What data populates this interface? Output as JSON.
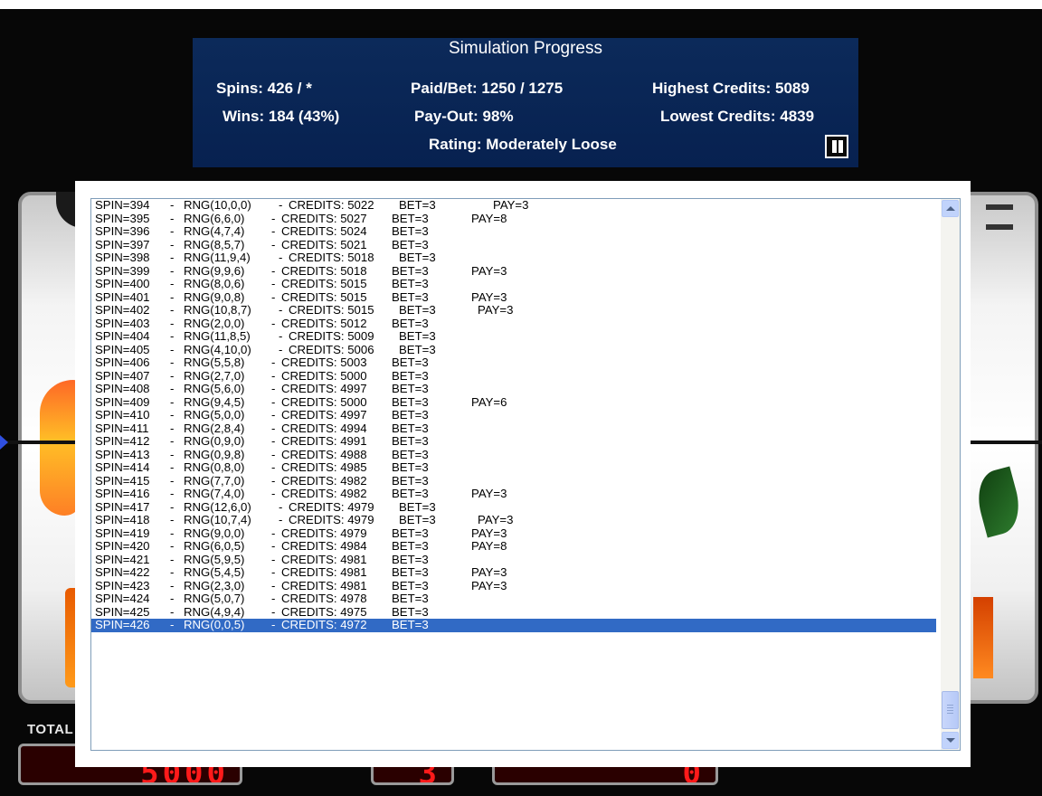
{
  "progress": {
    "title": "Simulation Progress",
    "spins": "Spins: 426 / *",
    "wins": "Wins: 184 (43%)",
    "paid_bet": "Paid/Bet: 1250 / 1275",
    "payout": "Pay-Out: 98%",
    "highest_credits": "Highest Credits: 5089",
    "lowest_credits": "Lowest Credits: 4839",
    "rating": "Rating: Moderately Loose"
  },
  "background": {
    "total_label": "TOTAL",
    "total_meter": "5000",
    "bet_meter": "3",
    "win_meter": "0"
  },
  "log": [
    {
      "spin": "SPIN=394",
      "rng": "RNG(10,0,0)",
      "credits": "CREDITS: 5022",
      "bet": "BET=3",
      "pay": "PAY=3",
      "payx": 444
    },
    {
      "spin": "SPIN=395",
      "rng": "RNG(6,6,0)",
      "credits": "CREDITS: 5027",
      "bet": "BET=3",
      "pay": "PAY=8",
      "payx": 420
    },
    {
      "spin": "SPIN=396",
      "rng": "RNG(4,7,4)",
      "credits": "CREDITS: 5024",
      "bet": "BET=3",
      "pay": ""
    },
    {
      "spin": "SPIN=397",
      "rng": "RNG(8,5,7)",
      "credits": "CREDITS: 5021",
      "bet": "BET=3",
      "pay": ""
    },
    {
      "spin": "SPIN=398",
      "rng": "RNG(11,9,4)",
      "credits": "CREDITS: 5018",
      "bet": "BET=3",
      "pay": ""
    },
    {
      "spin": "SPIN=399",
      "rng": "RNG(9,9,6)",
      "credits": "CREDITS: 5018",
      "bet": "BET=3",
      "pay": "PAY=3",
      "payx": 420
    },
    {
      "spin": "SPIN=400",
      "rng": "RNG(8,0,6)",
      "credits": "CREDITS: 5015",
      "bet": "BET=3",
      "pay": ""
    },
    {
      "spin": "SPIN=401",
      "rng": "RNG(9,0,8)",
      "credits": "CREDITS: 5015",
      "bet": "BET=3",
      "pay": "PAY=3",
      "payx": 420
    },
    {
      "spin": "SPIN=402",
      "rng": "RNG(10,8,7)",
      "credits": "CREDITS: 5015",
      "bet": "BET=3",
      "pay": "PAY=3",
      "payx": 427
    },
    {
      "spin": "SPIN=403",
      "rng": "RNG(2,0,0)",
      "credits": "CREDITS: 5012",
      "bet": "BET=3",
      "pay": ""
    },
    {
      "spin": "SPIN=404",
      "rng": "RNG(11,8,5)",
      "credits": "CREDITS: 5009",
      "bet": "BET=3",
      "pay": ""
    },
    {
      "spin": "SPIN=405",
      "rng": "RNG(4,10,0)",
      "credits": "CREDITS: 5006",
      "bet": "BET=3",
      "pay": ""
    },
    {
      "spin": "SPIN=406",
      "rng": "RNG(5,5,8)",
      "credits": "CREDITS: 5003",
      "bet": "BET=3",
      "pay": ""
    },
    {
      "spin": "SPIN=407",
      "rng": "RNG(2,7,0)",
      "credits": "CREDITS: 5000",
      "bet": "BET=3",
      "pay": ""
    },
    {
      "spin": "SPIN=408",
      "rng": "RNG(5,6,0)",
      "credits": "CREDITS: 4997",
      "bet": "BET=3",
      "pay": ""
    },
    {
      "spin": "SPIN=409",
      "rng": "RNG(9,4,5)",
      "credits": "CREDITS: 5000",
      "bet": "BET=3",
      "pay": "PAY=6",
      "payx": 420
    },
    {
      "spin": "SPIN=410",
      "rng": "RNG(5,0,0)",
      "credits": "CREDITS: 4997",
      "bet": "BET=3",
      "pay": ""
    },
    {
      "spin": "SPIN=411",
      "rng": "RNG(2,8,4)",
      "credits": "CREDITS: 4994",
      "bet": "BET=3",
      "pay": ""
    },
    {
      "spin": "SPIN=412",
      "rng": "RNG(0,9,0)",
      "credits": "CREDITS: 4991",
      "bet": "BET=3",
      "pay": ""
    },
    {
      "spin": "SPIN=413",
      "rng": "RNG(0,9,8)",
      "credits": "CREDITS: 4988",
      "bet": "BET=3",
      "pay": ""
    },
    {
      "spin": "SPIN=414",
      "rng": "RNG(0,8,0)",
      "credits": "CREDITS: 4985",
      "bet": "BET=3",
      "pay": ""
    },
    {
      "spin": "SPIN=415",
      "rng": "RNG(7,7,0)",
      "credits": "CREDITS: 4982",
      "bet": "BET=3",
      "pay": ""
    },
    {
      "spin": "SPIN=416",
      "rng": "RNG(7,4,0)",
      "credits": "CREDITS: 4982",
      "bet": "BET=3",
      "pay": "PAY=3",
      "payx": 420
    },
    {
      "spin": "SPIN=417",
      "rng": "RNG(12,6,0)",
      "credits": "CREDITS: 4979",
      "bet": "BET=3",
      "pay": ""
    },
    {
      "spin": "SPIN=418",
      "rng": "RNG(10,7,4)",
      "credits": "CREDITS: 4979",
      "bet": "BET=3",
      "pay": "PAY=3",
      "payx": 427
    },
    {
      "spin": "SPIN=419",
      "rng": "RNG(9,0,0)",
      "credits": "CREDITS: 4979",
      "bet": "BET=3",
      "pay": "PAY=3",
      "payx": 420
    },
    {
      "spin": "SPIN=420",
      "rng": "RNG(6,0,5)",
      "credits": "CREDITS: 4984",
      "bet": "BET=3",
      "pay": "PAY=8",
      "payx": 420
    },
    {
      "spin": "SPIN=421",
      "rng": "RNG(5,9,5)",
      "credits": "CREDITS: 4981",
      "bet": "BET=3",
      "pay": ""
    },
    {
      "spin": "SPIN=422",
      "rng": "RNG(5,4,5)",
      "credits": "CREDITS: 4981",
      "bet": "BET=3",
      "pay": "PAY=3",
      "payx": 420
    },
    {
      "spin": "SPIN=423",
      "rng": "RNG(2,3,0)",
      "credits": "CREDITS: 4981",
      "bet": "BET=3",
      "pay": "PAY=3",
      "payx": 420
    },
    {
      "spin": "SPIN=424",
      "rng": "RNG(5,0,7)",
      "credits": "CREDITS: 4978",
      "bet": "BET=3",
      "pay": ""
    },
    {
      "spin": "SPIN=425",
      "rng": "RNG(4,9,4)",
      "credits": "CREDITS: 4975",
      "bet": "BET=3",
      "pay": ""
    },
    {
      "spin": "SPIN=426",
      "rng": "RNG(0,0,5)",
      "credits": "CREDITS: 4972",
      "bet": "BET=3",
      "pay": "",
      "selected": true
    }
  ],
  "colors": {
    "panel_bg": "#0c2a5a",
    "selection": "#316ac5",
    "meter_digits": "#ff1a1a"
  }
}
